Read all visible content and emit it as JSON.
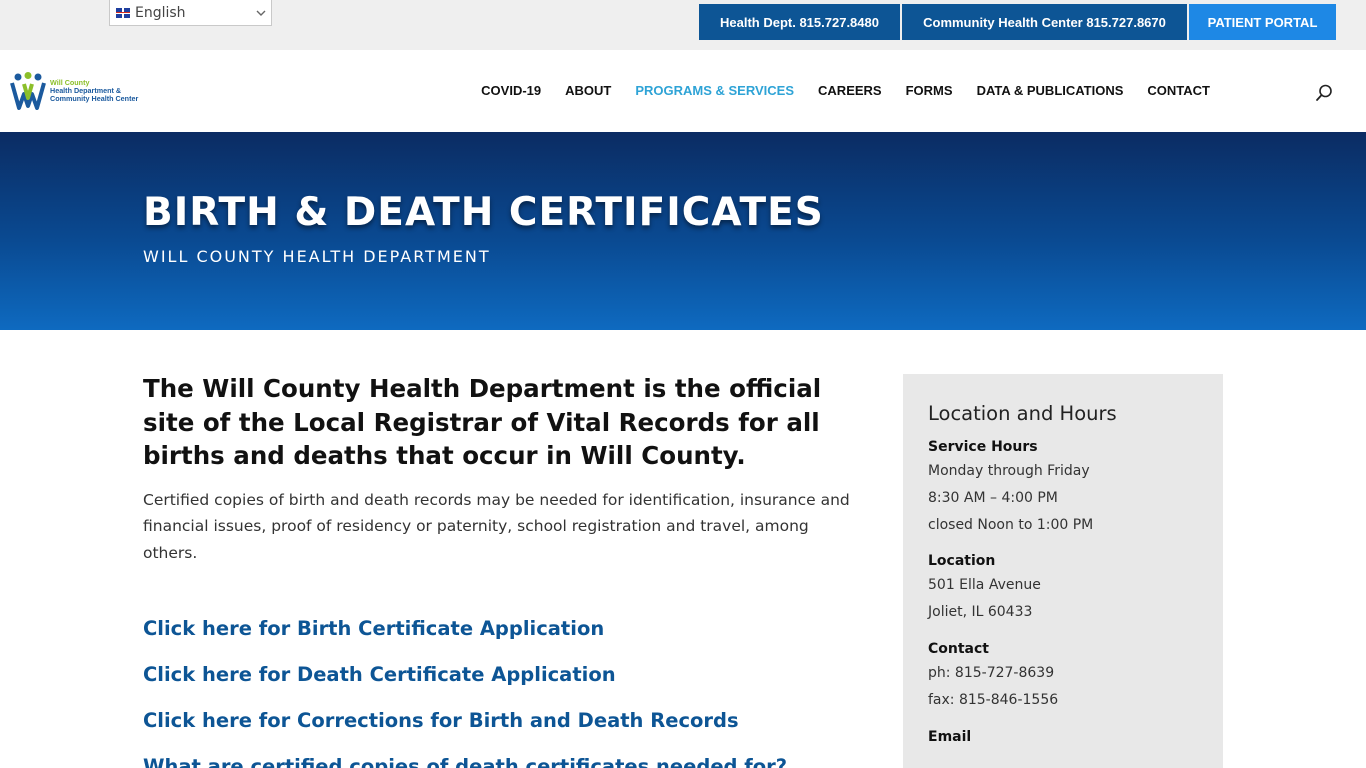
{
  "topbar": {
    "language": {
      "label": "English",
      "flag": "uk-flag-icon",
      "chevron": "chevron-down-icon"
    },
    "buttons": [
      {
        "label": "Health Dept. 815.727.8480",
        "color": "#0d5595"
      },
      {
        "label": "Community Health Center 815.727.8670",
        "color": "#0d5595"
      },
      {
        "label": "PATIENT PORTAL",
        "color": "#1e88e5"
      }
    ]
  },
  "header": {
    "logo": {
      "line1": "Will County",
      "line2": "Health Department &",
      "line3": "Community Health Center",
      "icon": "will-county-logo-icon"
    },
    "nav": [
      {
        "label": "COVID-19",
        "active": false
      },
      {
        "label": "ABOUT",
        "active": false
      },
      {
        "label": "PROGRAMS & SERVICES",
        "active": true
      },
      {
        "label": "CAREERS",
        "active": false
      },
      {
        "label": "FORMS",
        "active": false
      },
      {
        "label": "DATA & PUBLICATIONS",
        "active": false
      },
      {
        "label": "CONTACT",
        "active": false
      }
    ],
    "search_icon": "search-icon",
    "active_color": "#2ea3d6"
  },
  "hero": {
    "title": "BIRTH & DEATH CERTIFICATES",
    "subtitle": "WILL COUNTY HEALTH DEPARTMENT"
  },
  "main": {
    "lead": "The Will County Health Department is the official site of the Local Registrar of Vital Records for all births and deaths that occur in Will County.",
    "body": "Certified copies of birth and death records may be needed for identification, insurance and financial issues, proof of residency or paternity, school registration and travel, among others.",
    "links": [
      "Click here for Birth Certificate Application",
      "Click here for Death Certificate Application",
      "Click here for Corrections for Birth and Death Records",
      "What are certified copies of death certificates needed for?"
    ],
    "link_color": "#0d5595"
  },
  "sidebar": {
    "title": "Location and Hours",
    "service_hours": {
      "heading": "Service Hours",
      "lines": [
        "Monday through Friday",
        "8:30 AM – 4:00 PM",
        "closed Noon to 1:00 PM"
      ]
    },
    "location": {
      "heading": "Location",
      "lines": [
        "501 Ella Avenue",
        "Joliet, IL 60433"
      ]
    },
    "contact": {
      "heading": "Contact",
      "lines": [
        "ph: 815-727-8639",
        "fax: 815-846-1556"
      ]
    },
    "email": {
      "heading": "Email"
    }
  }
}
